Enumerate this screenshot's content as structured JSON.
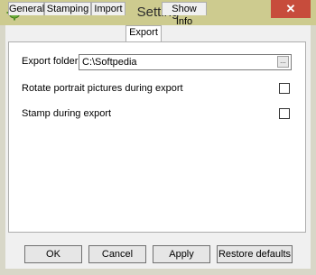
{
  "window": {
    "title": "Setting",
    "close_glyph": "✕",
    "icon": "gear-icon",
    "colors": {
      "titlebar": "#cdcb8f",
      "close": "#c74c3c",
      "frame": "#d8d7c8"
    }
  },
  "tabs": [
    {
      "label": "General",
      "active": false
    },
    {
      "label": "Stamping",
      "active": false
    },
    {
      "label": "Import",
      "active": false
    },
    {
      "label": "Export",
      "active": true
    },
    {
      "label": "Show Info",
      "active": false
    }
  ],
  "export": {
    "folder_label": "Export folder",
    "folder_value": "C:\\Softpedia",
    "browse_label": "...",
    "rotate_label": "Rotate portrait pictures during export",
    "rotate_checked": false,
    "stamp_label": "Stamp during export",
    "stamp_checked": false
  },
  "buttons": {
    "ok": "OK",
    "cancel": "Cancel",
    "apply": "Apply",
    "restore": "Restore defaults"
  }
}
